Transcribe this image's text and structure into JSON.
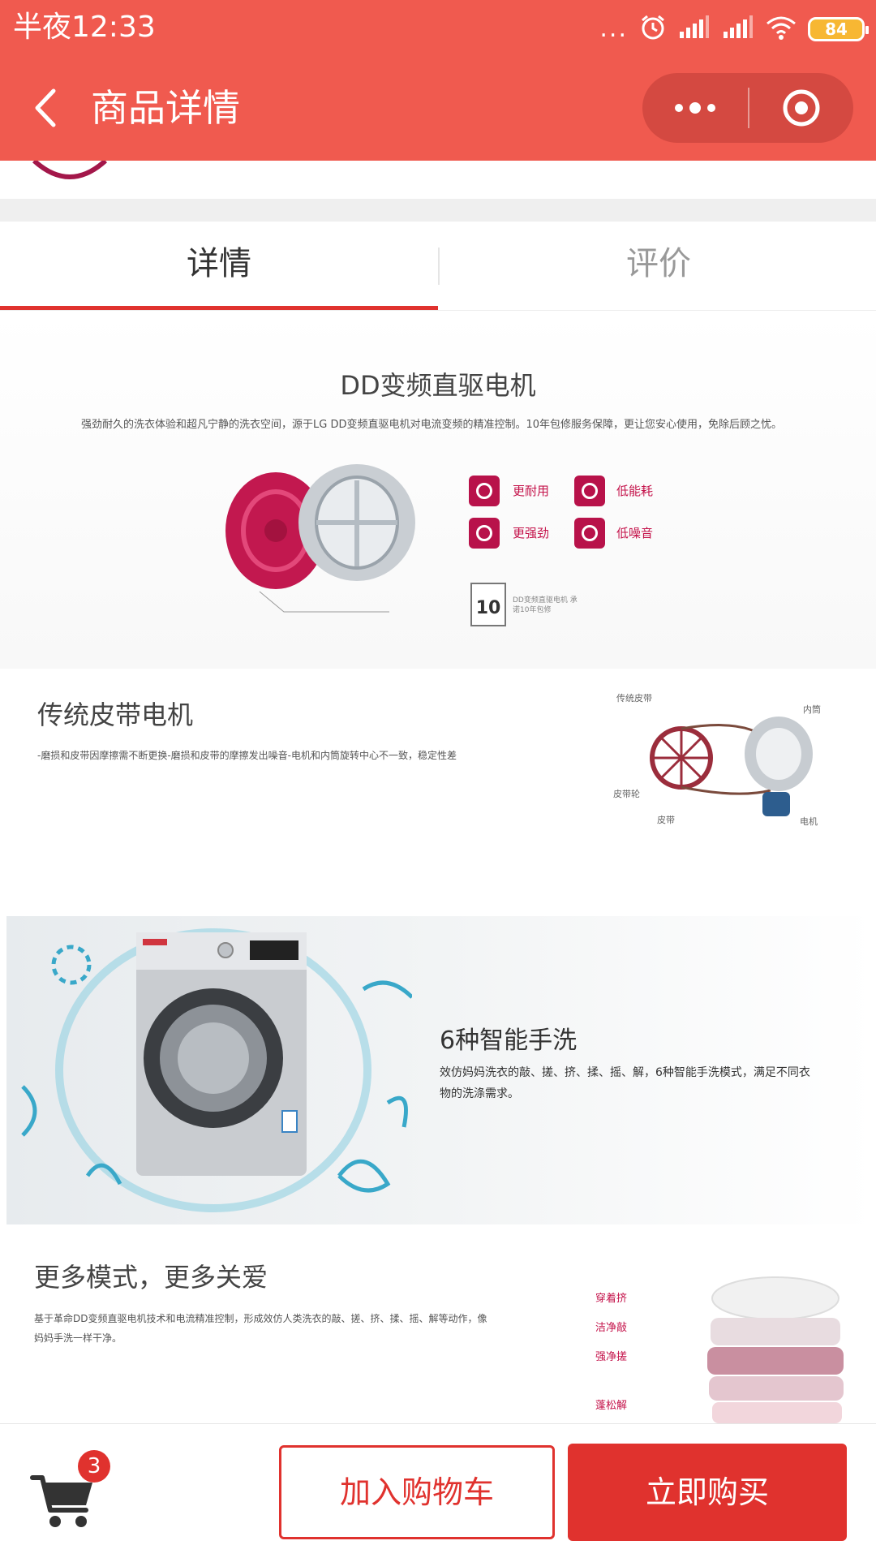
{
  "status_bar": {
    "time": "半夜12:33",
    "dots": "...",
    "battery": "84"
  },
  "nav": {
    "title": "商品详情"
  },
  "tabs": [
    {
      "label": "详情",
      "active": true
    },
    {
      "label": "评价",
      "active": false
    }
  ],
  "sections": {
    "dd_motor": {
      "title": "DD变频直驱电机",
      "desc": "强劲耐久的洗衣体验和超凡宁静的洗衣空间，源于LG DD变频直驱电机对电流变频的精准控制。10年包修服务保障，更让您安心使用，免除后顾之忧。",
      "features": [
        "更耐用",
        "低能耗",
        "更强劲",
        "低噪音"
      ],
      "warranty_text": "DD变频直驱电机 承诺10年包修"
    },
    "belt_motor": {
      "title": "传统皮带电机",
      "desc": "-磨损和皮带因摩擦需不断更换-磨损和皮带的摩擦发出噪音-电机和内筒旋转中心不一致，稳定性差",
      "labels": {
        "belt": "传统皮带",
        "drum": "内筒",
        "pulley": "皮带轮",
        "belt2": "皮带",
        "motor": "电机"
      }
    },
    "hand_wash": {
      "title": "6种智能手洗",
      "desc": "效仿妈妈洗衣的敲、搓、挤、揉、摇、解，6种智能手洗模式，满足不同衣物的洗涤需求。"
    },
    "more_modes": {
      "title": "更多模式，更多关爱",
      "desc": "基于革命DD变频直驱电机技术和电流精准控制，形成效仿人类洗衣的敲、搓、挤、揉、摇、解等动作，像妈妈手洗一样干净。",
      "modes": [
        "穿着挤",
        "洁净敲",
        "强净搓",
        "蓬松解"
      ]
    }
  },
  "bottom_bar": {
    "cart_count": "3",
    "add_to_cart": "加入购物车",
    "buy_now": "立即购买"
  },
  "colors": {
    "header": "#f05a4f",
    "accent": "#e0322e",
    "feature": "#c4124a"
  }
}
